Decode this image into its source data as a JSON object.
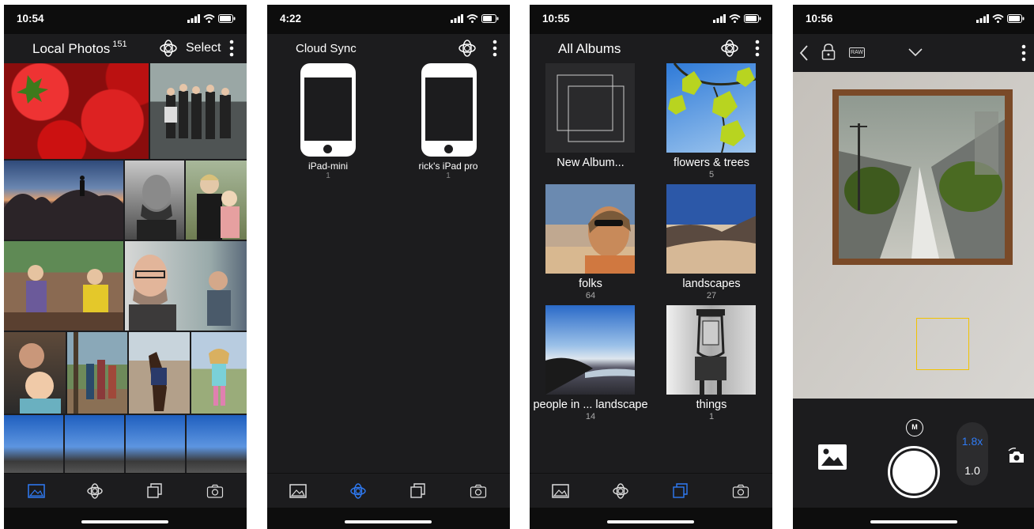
{
  "colors": {
    "accent": "#2f7bf5",
    "focus_box": "#f2c200",
    "background": "#1c1c1e",
    "bar": "#0d0d0d"
  },
  "screens": [
    {
      "status_time": "10:54",
      "title": "Local Photos",
      "count": "151",
      "select_label": "Select",
      "tabs": [
        "photos-icon",
        "cloud-sync-icon",
        "albums-icon",
        "camera-icon"
      ],
      "active_tab": 0
    },
    {
      "status_time": "4:22",
      "title": "Cloud Sync",
      "devices": [
        {
          "name": "iPad-mini",
          "count": "1"
        },
        {
          "name": "rick's iPad pro",
          "count": "1"
        }
      ],
      "active_tab": 1
    },
    {
      "status_time": "10:55",
      "title": "All Albums",
      "albums": [
        {
          "name": "New Album...",
          "count": ""
        },
        {
          "name": "flowers & trees",
          "count": "5"
        },
        {
          "name": "folks",
          "count": "64"
        },
        {
          "name": "landscapes",
          "count": "27"
        },
        {
          "name": "people in ... landscape",
          "count": "14"
        },
        {
          "name": "things",
          "count": "1"
        }
      ],
      "active_tab": 2
    },
    {
      "status_time": "10:56",
      "raw_label": "RAW",
      "mode_label": "M",
      "zoom_options": [
        "1.8x",
        "1.0"
      ],
      "selected_zoom": "1.8x"
    }
  ]
}
